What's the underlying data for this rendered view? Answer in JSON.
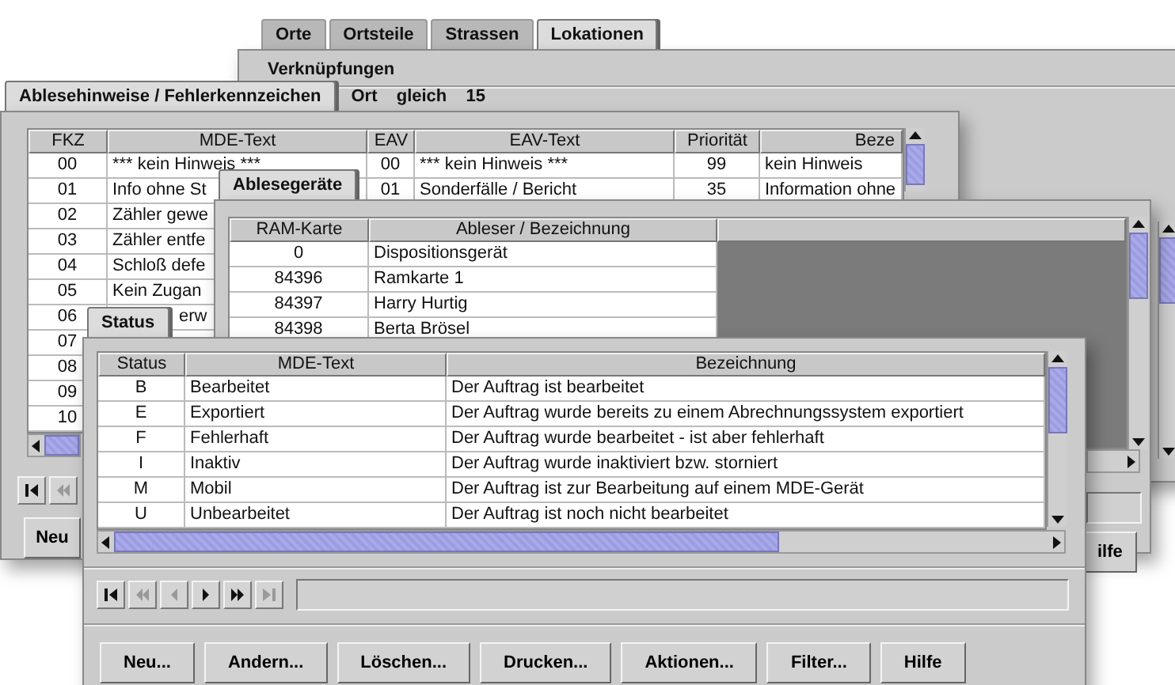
{
  "tab_window": {
    "tabs": [
      {
        "label": "Orte",
        "selected": false
      },
      {
        "label": "Ortsteile",
        "selected": false
      },
      {
        "label": "Strassen",
        "selected": false
      },
      {
        "label": "Lokationen",
        "selected": true
      }
    ],
    "group_label": "Verknüpfungen"
  },
  "hints_window": {
    "tabs": [
      {
        "label": "Ablesehinweise / Fehlerkennzeichen",
        "selected": true
      }
    ],
    "filter": "Ort  gleich  15",
    "columns": [
      "FKZ",
      "MDE-Text",
      "EAV",
      "EAV-Text",
      "Priorität",
      "Beze"
    ],
    "rows": [
      {
        "fkz": "00",
        "mde_text": "*** kein Hinweis ***",
        "eav": "00",
        "eav_text": "*** kein Hinweis ***",
        "priority": "99",
        "description": "kein Hinweis"
      },
      {
        "fkz": "01",
        "mde_text": "Info ohne St",
        "eav": "01",
        "eav_text": "Sonderfälle / Bericht",
        "priority": "35",
        "description": "Information ohne"
      },
      {
        "fkz": "02",
        "mde_text": "Zähler gewe"
      },
      {
        "fkz": "03",
        "mde_text": "Zähler entfe"
      },
      {
        "fkz": "04",
        "mde_text": "Schloß defe"
      },
      {
        "fkz": "05",
        "mde_text": "Kein Zugan"
      },
      {
        "fkz": "06",
        "mde_text_tail": "erw"
      },
      {
        "fkz": "07"
      },
      {
        "fkz": "08"
      },
      {
        "fkz": "09"
      },
      {
        "fkz": "10"
      }
    ],
    "nav": [
      {
        "kind": "first",
        "disabled": false
      },
      {
        "kind": "fast_back",
        "disabled": true
      }
    ],
    "button": "Neu"
  },
  "devices_window": {
    "tabs": [
      {
        "label": "Ablesegeräte",
        "selected": true
      }
    ],
    "columns": [
      "RAM-Karte",
      "Ableser / Bezeichnung"
    ],
    "rows": [
      [
        "0",
        "Dispositionsgerät"
      ],
      [
        "84396",
        "Ramkarte 1"
      ],
      [
        "84397",
        "Harry Hurtig"
      ],
      [
        "84398",
        "Berta Brösel"
      ]
    ],
    "button": "ilfe"
  },
  "status_window": {
    "tabs": [
      {
        "label": "Status",
        "selected": true
      }
    ],
    "columns": [
      "Status",
      "MDE-Text",
      "Bezeichnung"
    ],
    "rows": [
      [
        "B",
        "Bearbeitet",
        "Der Auftrag ist bearbeitet"
      ],
      [
        "E",
        "Exportiert",
        "Der Auftrag wurde bereits zu einem Abrechnungssystem exportiert"
      ],
      [
        "F",
        "Fehlerhaft",
        "Der Auftrag wurde bearbeitet - ist aber fehlerhaft"
      ],
      [
        "I",
        "Inaktiv",
        "Der Auftrag wurde inaktiviert bzw. storniert"
      ],
      [
        "M",
        "Mobil",
        "Der Auftrag ist zur Bearbeitung auf einem MDE-Gerät"
      ],
      [
        "U",
        "Unbearbeitet",
        "Der Auftrag ist noch nicht bearbeitet"
      ]
    ],
    "nav": [
      {
        "kind": "first",
        "disabled": false
      },
      {
        "kind": "fast_back",
        "disabled": true
      },
      {
        "kind": "back",
        "disabled": true
      },
      {
        "kind": "forward",
        "disabled": false
      },
      {
        "kind": "fast_forward",
        "disabled": false
      },
      {
        "kind": "last",
        "disabled": true
      }
    ],
    "buttons": [
      "Neu...",
      "Andern...",
      "Löschen...",
      "Drucken...",
      "Aktionen...",
      "Filter...",
      "Hilfe"
    ]
  }
}
